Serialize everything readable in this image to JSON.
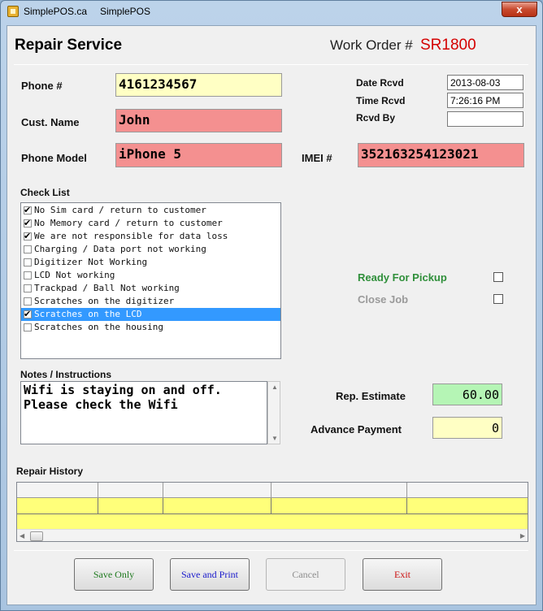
{
  "window": {
    "title_left": "SimplePOS.ca",
    "title_right": "SimplePOS",
    "close_label": "x"
  },
  "header": {
    "title": "Repair Service",
    "work_order_label": "Work Order #",
    "work_order_value": "SR1800"
  },
  "customer": {
    "phone_label": "Phone #",
    "phone_value": "4161234567",
    "name_label": "Cust. Name",
    "name_value": "John",
    "model_label": "Phone Model",
    "model_value": "iPhone 5",
    "imei_label": "IMEI #",
    "imei_value": "352163254123021"
  },
  "received": {
    "date_label": "Date Rcvd",
    "date_value": "2013-08-03",
    "time_label": "Time Rcvd",
    "time_value": "7:26:16 PM",
    "by_label": "Rcvd By",
    "by_value": ""
  },
  "checklist": {
    "label": "Check List",
    "items": [
      {
        "text": "No Sim card / return to customer",
        "checked": true,
        "selected": false
      },
      {
        "text": "No Memory card / return to customer",
        "checked": true,
        "selected": false
      },
      {
        "text": "We are not responsible for data loss",
        "checked": true,
        "selected": false
      },
      {
        "text": "Charging / Data port not working",
        "checked": false,
        "selected": false
      },
      {
        "text": "Digitizer Not Working",
        "checked": false,
        "selected": false
      },
      {
        "text": "LCD Not working",
        "checked": false,
        "selected": false
      },
      {
        "text": "Trackpad / Ball Not working",
        "checked": false,
        "selected": false
      },
      {
        "text": "Scratches on the digitizer",
        "checked": false,
        "selected": false
      },
      {
        "text": "Scratches on the LCD",
        "checked": true,
        "selected": true
      },
      {
        "text": "Scratches on the housing",
        "checked": false,
        "selected": false
      }
    ]
  },
  "status": {
    "ready_label": "Ready For Pickup",
    "ready_checked": false,
    "close_label": "Close Job",
    "close_checked": false
  },
  "notes": {
    "label": "Notes / Instructions",
    "value": "Wifi is staying on and off.\nPlease check the Wifi"
  },
  "payment": {
    "estimate_label": "Rep. Estimate",
    "estimate_value": "60.00",
    "advance_label": "Advance Payment",
    "advance_value": "0"
  },
  "history": {
    "label": "Repair History"
  },
  "buttons": {
    "save_only": "Save Only",
    "save_print": "Save and Print",
    "cancel": "Cancel",
    "exit": "Exit"
  },
  "colors": {
    "work_order": "#d40000",
    "ready": "#2f8f3a",
    "save_only_text": "#1f7a1f",
    "save_print_text": "#1a1acc",
    "exit_text": "#cc1111",
    "field_yellow": "#ffffc4",
    "field_pink": "#f49090",
    "field_green": "#b5f5b5"
  }
}
